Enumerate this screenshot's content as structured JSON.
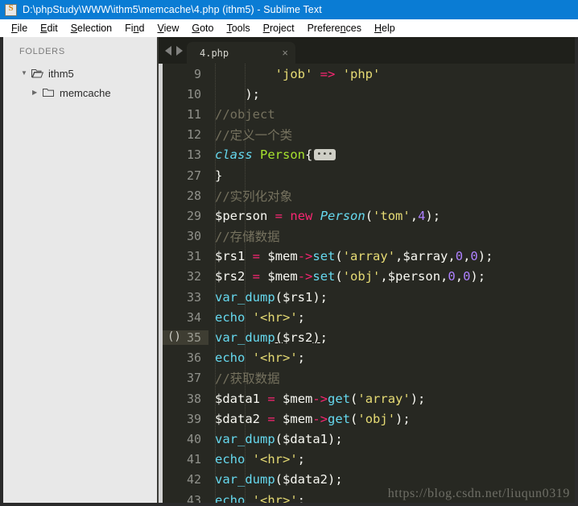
{
  "window": {
    "title": "D:\\phpStudy\\WWW\\ithm5\\memcache\\4.php (ithm5) - Sublime Text",
    "app_icon": "sublime-text-icon",
    "titlebar_color": "#0a7cd4"
  },
  "menubar": {
    "items": [
      {
        "label": "File",
        "mnemonic": "F"
      },
      {
        "label": "Edit",
        "mnemonic": "E"
      },
      {
        "label": "Selection",
        "mnemonic": "S"
      },
      {
        "label": "Find",
        "mnemonic": "n"
      },
      {
        "label": "View",
        "mnemonic": "V"
      },
      {
        "label": "Goto",
        "mnemonic": "G"
      },
      {
        "label": "Tools",
        "mnemonic": "T"
      },
      {
        "label": "Project",
        "mnemonic": "P"
      },
      {
        "label": "Preferences",
        "mnemonic": "n"
      },
      {
        "label": "Help",
        "mnemonic": "H"
      }
    ]
  },
  "sidebar": {
    "header": "FOLDERS",
    "tree": [
      {
        "label": "ithm5",
        "level": 1,
        "expanded": true,
        "twisty": "▼",
        "icon": "folder-open-icon"
      },
      {
        "label": "memcache",
        "level": 2,
        "expanded": false,
        "twisty": "▶",
        "icon": "folder-closed-icon"
      }
    ]
  },
  "tabbar": {
    "nav_back": "back-arrow",
    "nav_forward": "forward-arrow",
    "tabs": [
      {
        "title": "4.php",
        "active": true,
        "close": "×"
      }
    ]
  },
  "editor": {
    "active_line": 35,
    "bracket_indicator": "()",
    "fold_marker_glyph": "•••",
    "colors": {
      "background": "#272822",
      "gutter_text": "#90918b",
      "active_line_gutter": "#3e3d32",
      "comment": "#75715e",
      "string": "#e6db74",
      "keyword": "#f92672",
      "function": "#66d9ef",
      "class_def": "#a6e22e",
      "number": "#ae81ff",
      "plain": "#f8f8f2"
    },
    "lines": [
      {
        "n": "9",
        "tokens": [
          {
            "t": "        ",
            "c": "pun"
          },
          {
            "t": "'job'",
            "c": "str"
          },
          {
            "t": " ",
            "c": "pun"
          },
          {
            "t": "=>",
            "c": "op"
          },
          {
            "t": " ",
            "c": "pun"
          },
          {
            "t": "'php'",
            "c": "str"
          }
        ]
      },
      {
        "n": "10",
        "tokens": [
          {
            "t": "    );",
            "c": "pun"
          }
        ]
      },
      {
        "n": "11",
        "tokens": [
          {
            "t": "//object",
            "c": "com"
          }
        ]
      },
      {
        "n": "12",
        "tokens": [
          {
            "t": "//定义一个类",
            "c": "com"
          }
        ]
      },
      {
        "n": "13",
        "tokens": [
          {
            "t": "class",
            "c": "cls"
          },
          {
            "t": " ",
            "c": "pun"
          },
          {
            "t": "Person",
            "c": "def"
          },
          {
            "t": "{",
            "c": "pun"
          },
          {
            "t": "FOLD",
            "c": "fold"
          }
        ]
      },
      {
        "n": "27",
        "tokens": [
          {
            "t": "}",
            "c": "pun"
          }
        ]
      },
      {
        "n": "28",
        "tokens": [
          {
            "t": "//实列化对象",
            "c": "com"
          }
        ]
      },
      {
        "n": "29",
        "tokens": [
          {
            "t": "$person",
            "c": "var"
          },
          {
            "t": " ",
            "c": "pun"
          },
          {
            "t": "=",
            "c": "op"
          },
          {
            "t": " ",
            "c": "pun"
          },
          {
            "t": "new",
            "c": "kw"
          },
          {
            "t": " ",
            "c": "pun"
          },
          {
            "t": "Person",
            "c": "cls"
          },
          {
            "t": "(",
            "c": "pun"
          },
          {
            "t": "'tom'",
            "c": "str"
          },
          {
            "t": ",",
            "c": "pun"
          },
          {
            "t": "4",
            "c": "num"
          },
          {
            "t": ");",
            "c": "pun"
          }
        ]
      },
      {
        "n": "30",
        "tokens": [
          {
            "t": "//存储数据",
            "c": "com"
          }
        ]
      },
      {
        "n": "31",
        "tokens": [
          {
            "t": "$rs1",
            "c": "var"
          },
          {
            "t": " ",
            "c": "pun"
          },
          {
            "t": "=",
            "c": "op"
          },
          {
            "t": " ",
            "c": "pun"
          },
          {
            "t": "$mem",
            "c": "var"
          },
          {
            "t": "->",
            "c": "op"
          },
          {
            "t": "set",
            "c": "fn"
          },
          {
            "t": "(",
            "c": "pun"
          },
          {
            "t": "'array'",
            "c": "str"
          },
          {
            "t": ",",
            "c": "pun"
          },
          {
            "t": "$array",
            "c": "var"
          },
          {
            "t": ",",
            "c": "pun"
          },
          {
            "t": "0",
            "c": "num"
          },
          {
            "t": ",",
            "c": "pun"
          },
          {
            "t": "0",
            "c": "num"
          },
          {
            "t": ");",
            "c": "pun"
          }
        ]
      },
      {
        "n": "32",
        "tokens": [
          {
            "t": "$rs2",
            "c": "var"
          },
          {
            "t": " ",
            "c": "pun"
          },
          {
            "t": "=",
            "c": "op"
          },
          {
            "t": " ",
            "c": "pun"
          },
          {
            "t": "$mem",
            "c": "var"
          },
          {
            "t": "->",
            "c": "op"
          },
          {
            "t": "set",
            "c": "fn"
          },
          {
            "t": "(",
            "c": "pun"
          },
          {
            "t": "'obj'",
            "c": "str"
          },
          {
            "t": ",",
            "c": "pun"
          },
          {
            "t": "$person",
            "c": "var"
          },
          {
            "t": ",",
            "c": "pun"
          },
          {
            "t": "0",
            "c": "num"
          },
          {
            "t": ",",
            "c": "pun"
          },
          {
            "t": "0",
            "c": "num"
          },
          {
            "t": ");",
            "c": "pun"
          }
        ]
      },
      {
        "n": "33",
        "tokens": [
          {
            "t": "var_dump",
            "c": "fn"
          },
          {
            "t": "(",
            "c": "pun"
          },
          {
            "t": "$rs1",
            "c": "var"
          },
          {
            "t": ");",
            "c": "pun"
          }
        ]
      },
      {
        "n": "34",
        "tokens": [
          {
            "t": "echo",
            "c": "fn"
          },
          {
            "t": " ",
            "c": "pun"
          },
          {
            "t": "'<hr>'",
            "c": "str"
          },
          {
            "t": ";",
            "c": "pun"
          }
        ]
      },
      {
        "n": "35",
        "active": true,
        "tokens": [
          {
            "t": "var_dump",
            "c": "fn"
          },
          {
            "t": "(",
            "c": "brk"
          },
          {
            "t": "$rs2",
            "c": "var"
          },
          {
            "t": ")",
            "c": "brk"
          },
          {
            "t": ";",
            "c": "pun"
          }
        ]
      },
      {
        "n": "36",
        "tokens": [
          {
            "t": "echo",
            "c": "fn"
          },
          {
            "t": " ",
            "c": "pun"
          },
          {
            "t": "'<hr>'",
            "c": "str"
          },
          {
            "t": ";",
            "c": "pun"
          }
        ]
      },
      {
        "n": "37",
        "tokens": [
          {
            "t": "//获取数据",
            "c": "com"
          }
        ]
      },
      {
        "n": "38",
        "tokens": [
          {
            "t": "$data1",
            "c": "var"
          },
          {
            "t": " ",
            "c": "pun"
          },
          {
            "t": "=",
            "c": "op"
          },
          {
            "t": " ",
            "c": "pun"
          },
          {
            "t": "$mem",
            "c": "var"
          },
          {
            "t": "->",
            "c": "op"
          },
          {
            "t": "get",
            "c": "fn"
          },
          {
            "t": "(",
            "c": "pun"
          },
          {
            "t": "'array'",
            "c": "str"
          },
          {
            "t": ");",
            "c": "pun"
          }
        ]
      },
      {
        "n": "39",
        "tokens": [
          {
            "t": "$data2",
            "c": "var"
          },
          {
            "t": " ",
            "c": "pun"
          },
          {
            "t": "=",
            "c": "op"
          },
          {
            "t": " ",
            "c": "pun"
          },
          {
            "t": "$mem",
            "c": "var"
          },
          {
            "t": "->",
            "c": "op"
          },
          {
            "t": "get",
            "c": "fn"
          },
          {
            "t": "(",
            "c": "pun"
          },
          {
            "t": "'obj'",
            "c": "str"
          },
          {
            "t": ");",
            "c": "pun"
          }
        ]
      },
      {
        "n": "40",
        "tokens": [
          {
            "t": "var_dump",
            "c": "fn"
          },
          {
            "t": "(",
            "c": "pun"
          },
          {
            "t": "$data1",
            "c": "var"
          },
          {
            "t": ");",
            "c": "pun"
          }
        ]
      },
      {
        "n": "41",
        "tokens": [
          {
            "t": "echo",
            "c": "fn"
          },
          {
            "t": " ",
            "c": "pun"
          },
          {
            "t": "'<hr>'",
            "c": "str"
          },
          {
            "t": ";",
            "c": "pun"
          }
        ]
      },
      {
        "n": "42",
        "tokens": [
          {
            "t": "var_dump",
            "c": "fn"
          },
          {
            "t": "(",
            "c": "pun"
          },
          {
            "t": "$data2",
            "c": "var"
          },
          {
            "t": ");",
            "c": "pun"
          }
        ]
      },
      {
        "n": "43",
        "tokens": [
          {
            "t": "echo",
            "c": "fn"
          },
          {
            "t": " ",
            "c": "pun"
          },
          {
            "t": "'<hr>'",
            "c": "str"
          },
          {
            "t": ";",
            "c": "pun"
          }
        ]
      }
    ]
  },
  "watermark": {
    "text": "https://blog.csdn.net/liuqun0319"
  }
}
